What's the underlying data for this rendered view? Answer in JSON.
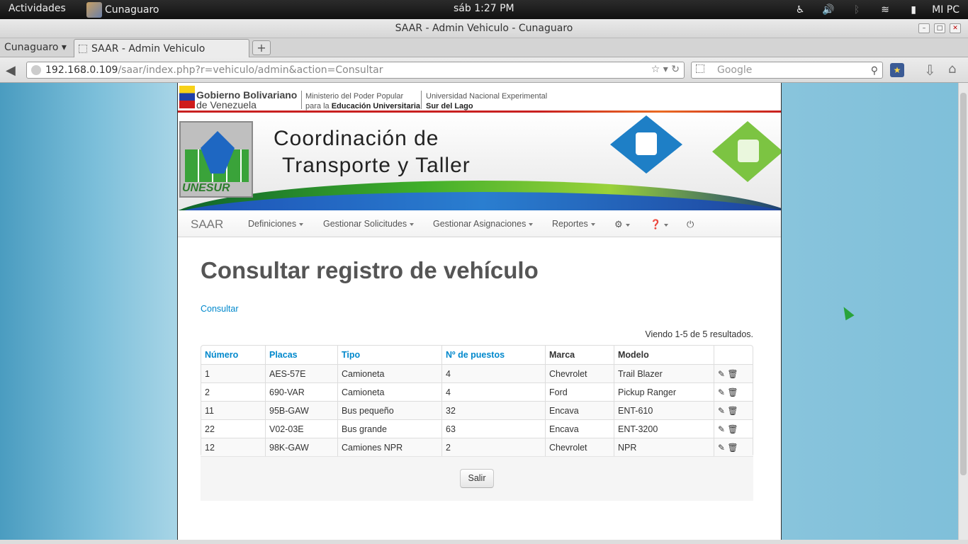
{
  "topbar": {
    "activities": "Actividades",
    "app_name": "Cunaguaro",
    "clock": "sáb  1:27 PM",
    "user": "MI PC"
  },
  "window": {
    "title": "SAAR - Admin Vehiculo - Cunaguaro"
  },
  "tabs": {
    "group": "Cunaguaro ▾",
    "active_tab": "SAAR - Admin Vehiculo",
    "new_tab": "+"
  },
  "nav": {
    "url_host": "192.168.0.109",
    "url_path": "/saar/index.php?r=vehiculo/admin&action=Consultar",
    "search_placeholder": "Google"
  },
  "header": {
    "gov_line1": "Gobierno Bolivariano",
    "gov_line2": "de Venezuela",
    "ministry_line1": "Ministerio del Poder Popular",
    "ministry_line2a": "para la",
    "ministry_line2b": "Educación Universitaria",
    "univ_line1": "Universidad Nacional Experimental",
    "univ_line2": "Sur del Lago",
    "banner_title_1": "Coordinación de",
    "banner_title_2": "Transporte y Taller",
    "logo_text": "UNESUR"
  },
  "appnav": {
    "brand": "SAAR",
    "items": [
      "Definiciones",
      "Gestionar Solicitudes",
      "Gestionar Asignaciones",
      "Reportes"
    ]
  },
  "main": {
    "page_title": "Consultar registro de vehículo",
    "breadcrumb": "Consultar",
    "summary": "Viendo 1-5 de 5 resultados.",
    "columns": [
      "Número",
      "Placas",
      "Tipo",
      "Nº de puestos",
      "Marca",
      "Modelo"
    ],
    "rows": [
      [
        "1",
        "AES-57E",
        "Camioneta",
        "4",
        "Chevrolet",
        "Trail Blazer"
      ],
      [
        "2",
        "690-VAR",
        "Camioneta",
        "4",
        "Ford",
        "Pickup Ranger"
      ],
      [
        "11",
        "95B-GAW",
        "Bus pequeño",
        "32",
        "Encava",
        "ENT-610"
      ],
      [
        "22",
        "V02-03E",
        "Bus grande",
        "63",
        "Encava",
        "ENT-3200"
      ],
      [
        "12",
        "98K-GAW",
        "Camiones NPR",
        "2",
        "Chevrolet",
        "NPR"
      ]
    ],
    "exit_button": "Salir"
  },
  "colors": {
    "link": "#0088cc",
    "cursor": "#29a33a"
  }
}
